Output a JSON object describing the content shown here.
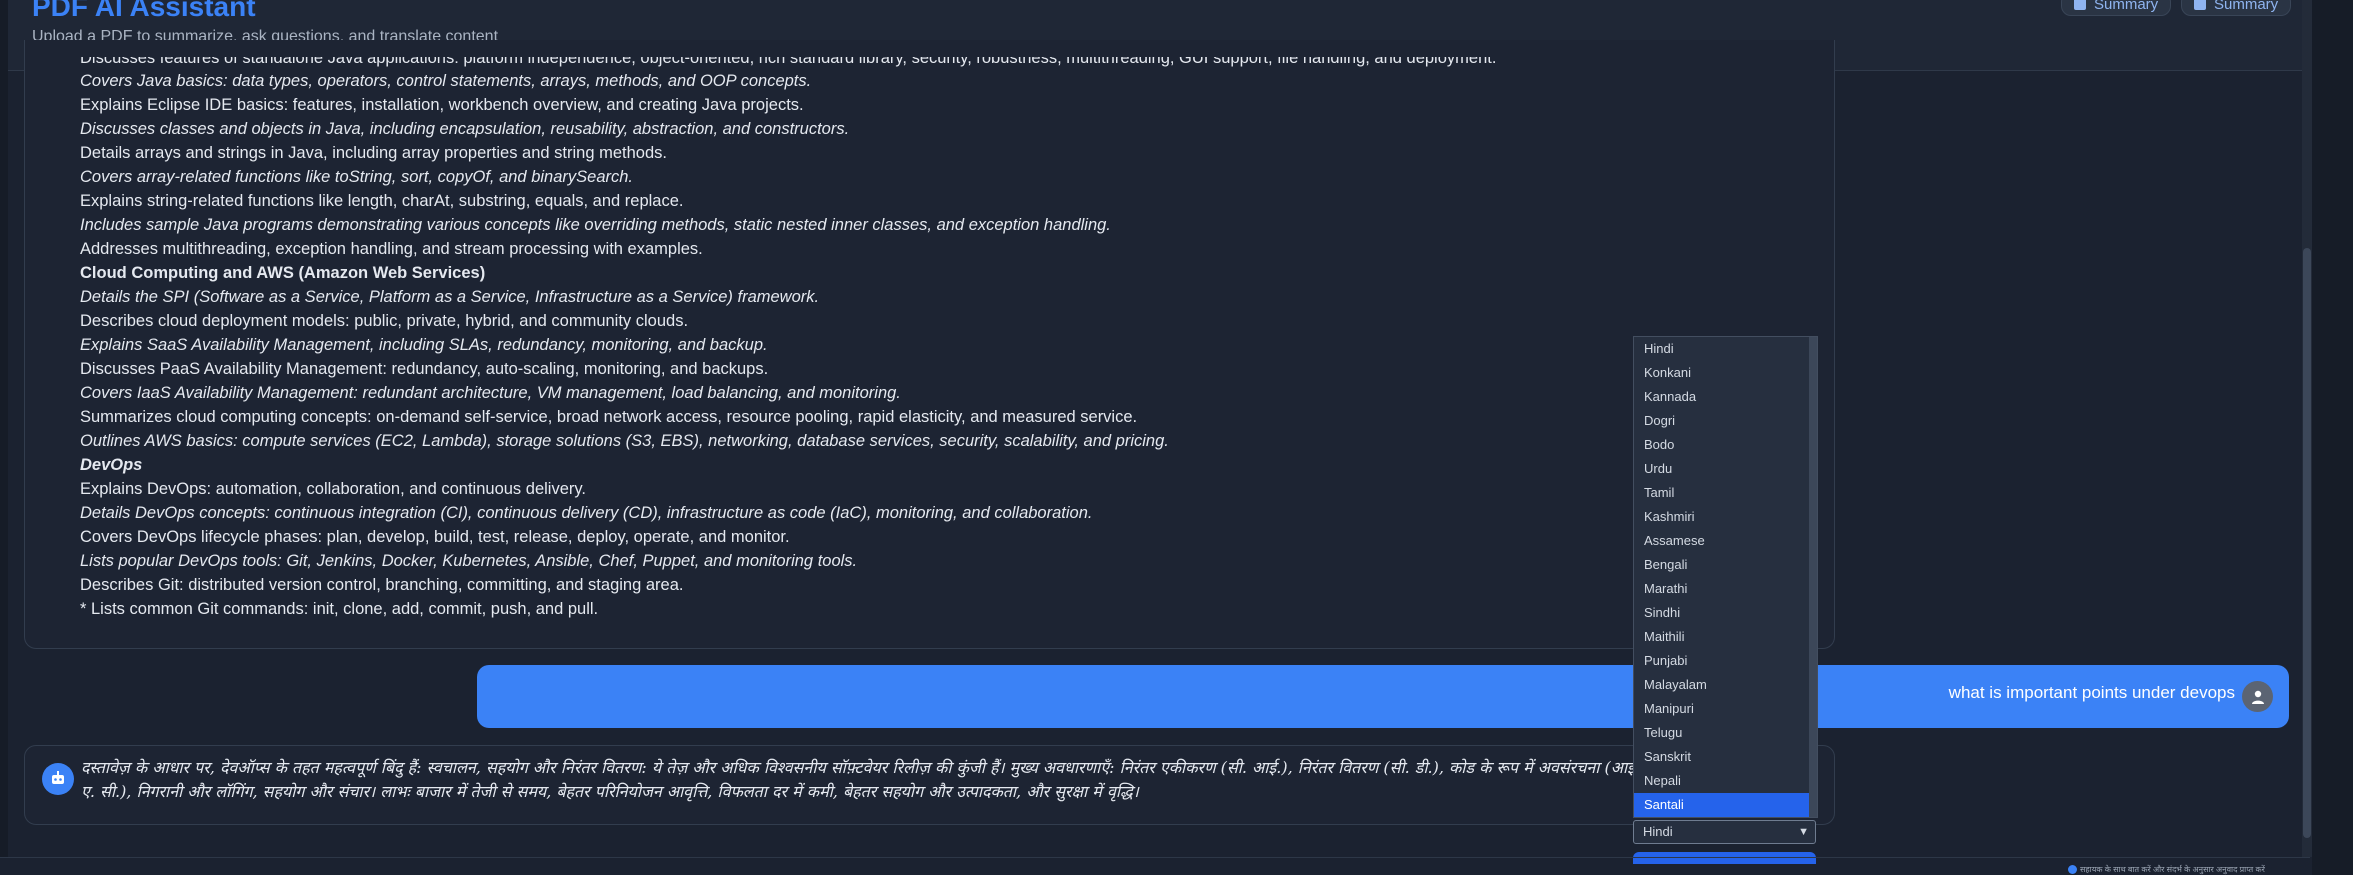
{
  "header": {
    "title": "PDF AI Assistant",
    "subtitle": "Upload a PDF to summarize, ask questions, and translate content",
    "buttons": [
      {
        "label": "Summary",
        "icon": "download-icon"
      },
      {
        "label": "Summary",
        "icon": "file-icon"
      }
    ]
  },
  "summary": {
    "lines": [
      {
        "text": "Discusses features of standalone Java applications: platform independence, object-oriented, rich standard library, security, robustness, multithreading, GUI support, file handling, and deployment.",
        "style": "cut"
      },
      {
        "text": "Covers Java basics: data types, operators, control statements, arrays, methods, and OOP concepts.",
        "style": "italic"
      },
      {
        "text": "Explains Eclipse IDE basics: features, installation, workbench overview, and creating Java projects.",
        "style": "normal"
      },
      {
        "text": "Discusses classes and objects in Java, including encapsulation, reusability, abstraction, and constructors.",
        "style": "italic"
      },
      {
        "text": "Details arrays and strings in Java, including array properties and string methods.",
        "style": "normal"
      },
      {
        "text": "Covers array-related functions like toString, sort, copyOf, and binarySearch.",
        "style": "italic"
      },
      {
        "text": "Explains string-related functions like length, charAt, substring, equals, and replace.",
        "style": "normal"
      },
      {
        "text": "Includes sample Java programs demonstrating various concepts like overriding methods, static nested inner classes, and exception handling.",
        "style": "italic"
      },
      {
        "text": "Addresses multithreading, exception handling, and stream processing with examples.",
        "style": "normal"
      },
      {
        "text": "Cloud Computing and AWS (Amazon Web Services)",
        "style": "bold"
      },
      {
        "text": "Details the SPI (Software as a Service, Platform as a Service, Infrastructure as a Service) framework.",
        "style": "italic"
      },
      {
        "text": "Describes cloud deployment models: public, private, hybrid, and community clouds.",
        "style": "normal"
      },
      {
        "text": "Explains SaaS Availability Management, including SLAs, redundancy, monitoring, and backup.",
        "style": "italic"
      },
      {
        "text": "Discusses PaaS Availability Management: redundancy, auto-scaling, monitoring, and backups.",
        "style": "normal"
      },
      {
        "text": "Covers IaaS Availability Management: redundant architecture, VM management, load balancing, and monitoring.",
        "style": "italic"
      },
      {
        "text": "Summarizes cloud computing concepts: on-demand self-service, broad network access, resource pooling, rapid elasticity, and measured service.",
        "style": "normal"
      },
      {
        "text": "Outlines AWS basics: compute services (EC2, Lambda), storage solutions (S3, EBS), networking, database services, security, scalability, and pricing.",
        "style": "italic"
      },
      {
        "text": "DevOps",
        "style": "bold-italic"
      },
      {
        "text": "Explains DevOps: automation, collaboration, and continuous delivery.",
        "style": "normal"
      },
      {
        "text": "Details DevOps concepts: continuous integration (CI), continuous delivery (CD), infrastructure as code (IaC), monitoring, and collaboration.",
        "style": "italic"
      },
      {
        "text": "Covers DevOps lifecycle phases: plan, develop, build, test, release, deploy, operate, and monitor.",
        "style": "normal"
      },
      {
        "text": "Lists popular DevOps tools: Git, Jenkins, Docker, Kubernetes, Ansible, Chef, Puppet, and monitoring tools.",
        "style": "italic"
      },
      {
        "text": "Describes Git: distributed version control, branching, committing, and staging area.",
        "style": "normal"
      },
      {
        "text": "* Lists common Git commands: init, clone, add, commit, push, and pull.",
        "style": "normal"
      }
    ]
  },
  "chat": {
    "user_message": "what is important points under devops",
    "ai_message": "दस्तावेज़ के आधार पर, देवऑप्स के तहत महत्वपूर्ण बिंदु हैं: स्वचालन, सहयोग और निरंतर वितरण: ये तेज़ और अधिक विश्वसनीय सॉफ़्टवेयर रिलीज़ की कुंजी हैं। मुख्य अवधारणाएँ: निरंतर एकीकरण (सी. आई.), निरंतर वितरण (सी. डी.), कोड के रूप में अवसंरचना (आई. ए. सी.), निगरानी और लॉगिंग, सहयोग और संचार। लाभः बाजार में तेजी से समय, बेहतर परिनियोजन आवृत्ति, विफलता दर में कमी, बेहतर सहयोग और उत्पादकता, और सुरक्षा में वृद्धि।"
  },
  "language_select": {
    "value": "Hindi",
    "options": [
      "Hindi",
      "Konkani",
      "Kannada",
      "Dogri",
      "Bodo",
      "Urdu",
      "Tamil",
      "Kashmiri",
      "Assamese",
      "Bengali",
      "Marathi",
      "Sindhi",
      "Maithili",
      "Punjabi",
      "Malayalam",
      "Manipuri",
      "Telugu",
      "Sanskrit",
      "Nepali",
      "Santali"
    ],
    "highlighted": "Santali"
  },
  "corner_hint": "सहायक के साथ बात करें और संदर्भ के अनुसार अनुवाद प्राप्त करें",
  "colors": {
    "accent": "#3b82f6",
    "background": "#1b2230",
    "card": "#1d2433"
  }
}
